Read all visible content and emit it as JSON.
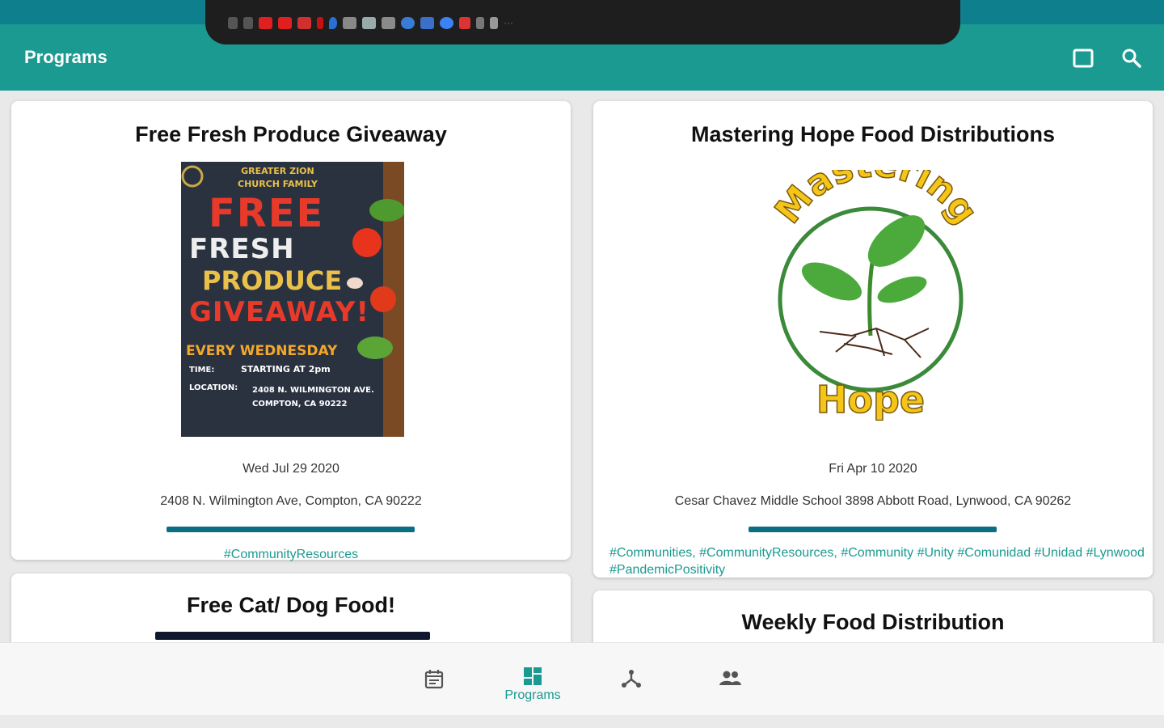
{
  "colors": {
    "primary": "#1a9a90",
    "status_bar": "#0e7f8c",
    "accent_bar": "#0b6e82",
    "tag": "#1a9a90"
  },
  "appbar": {
    "title": "Programs",
    "icons": [
      "square-icon",
      "search-icon"
    ]
  },
  "programs": [
    {
      "title": "Free Fresh Produce Giveaway",
      "date": "Wed Jul 29 2020",
      "address": "2408 N. Wilmington Ave, Compton, CA 90222",
      "tags": "#CommunityResources",
      "poster": {
        "header": "GREATER ZION\nCHURCH FAMILY",
        "line1": "FREE",
        "line2": "FRESH",
        "line3": "PRODUCE",
        "line4": "GIVEAWAY!",
        "line5": "EVERY WEDNESDAY",
        "time_label": "TIME:",
        "time_value": "STARTING AT 2pm",
        "location_label": "LOCATION:",
        "location_value": "2408 N. WILMINGTON AVE.\nCOMPTON, CA 90222"
      }
    },
    {
      "title": "Mastering Hope Food Distributions",
      "date": "Fri Apr 10 2020",
      "address": "Cesar Chavez Middle School 3898 Abbott Road, Lynwood, CA 90262",
      "tags": "#Communities, #CommunityResources, #Community #Unity #Comunidad #Unidad #Lynwood #PandemicPositivity",
      "logo": {
        "top_text": "Mastering",
        "bottom_text": "Hope"
      }
    },
    {
      "title": "Free Cat/ Dog Food!"
    },
    {
      "title": "Weekly Food Distribution"
    }
  ],
  "bottom_nav": {
    "items": [
      {
        "icon": "calendar-icon",
        "label": ""
      },
      {
        "icon": "dashboard-icon",
        "label": "Programs",
        "active": true
      },
      {
        "icon": "network-icon",
        "label": ""
      },
      {
        "icon": "people-icon",
        "label": ""
      }
    ]
  }
}
